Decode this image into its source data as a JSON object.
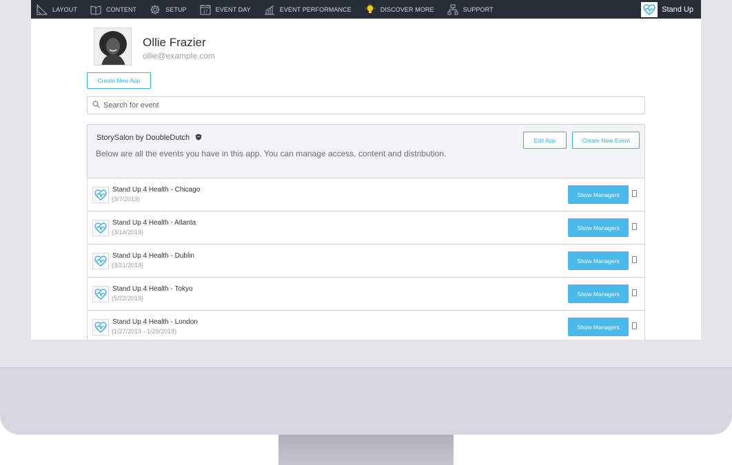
{
  "nav": {
    "items": [
      {
        "label": "LAYOUT",
        "icon": "layout-icon"
      },
      {
        "label": "CONTENT",
        "icon": "book-icon"
      },
      {
        "label": "SETUP",
        "icon": "gear-icon"
      },
      {
        "label": "EVENT DAY",
        "icon": "calendar-icon",
        "icon_text": "17"
      },
      {
        "label": "EVENT PERFORMANCE",
        "icon": "bar-chart-icon"
      },
      {
        "label": "DISCOVER MORE",
        "icon": "lightbulb-icon"
      },
      {
        "label": "SUPPORT",
        "icon": "network-icon"
      }
    ],
    "brand": "Stand Up",
    "accent": "#f5c518"
  },
  "profile": {
    "name": "Ollie Frazier",
    "email": "ollie@example.com"
  },
  "actions": {
    "create_app": "Create New App"
  },
  "search": {
    "placeholder": "Search for event"
  },
  "app": {
    "title": "StorySalon by DoubleDutch",
    "description": "Below are all the events you have in this app. You can manage access, content and distribution.",
    "edit_label": "Edit App",
    "create_event_label": "Create New Event"
  },
  "events": [
    {
      "name": "Stand Up 4 Health - Chicago",
      "date": "(3/7/2019)",
      "button": "Show Managers"
    },
    {
      "name": "Stand Up 4 Health - Atlanta",
      "date": "(3/14/2019)",
      "button": "Show Managers"
    },
    {
      "name": "Stand Up 4 Health - Dublin",
      "date": "(3/21/2019)",
      "button": "Show Managers"
    },
    {
      "name": "Stand Up 4 Health - Tokyo",
      "date": "(5/22/2019)",
      "button": "Show Managers"
    },
    {
      "name": "Stand Up 4 Health - London",
      "date": "(1/27/2019 - 1/29/2019)",
      "button": "Show Managers"
    }
  ],
  "colors": {
    "nav_bg": "#262d36",
    "primary": "#49b9ec",
    "outline": "#2fb2ea"
  }
}
